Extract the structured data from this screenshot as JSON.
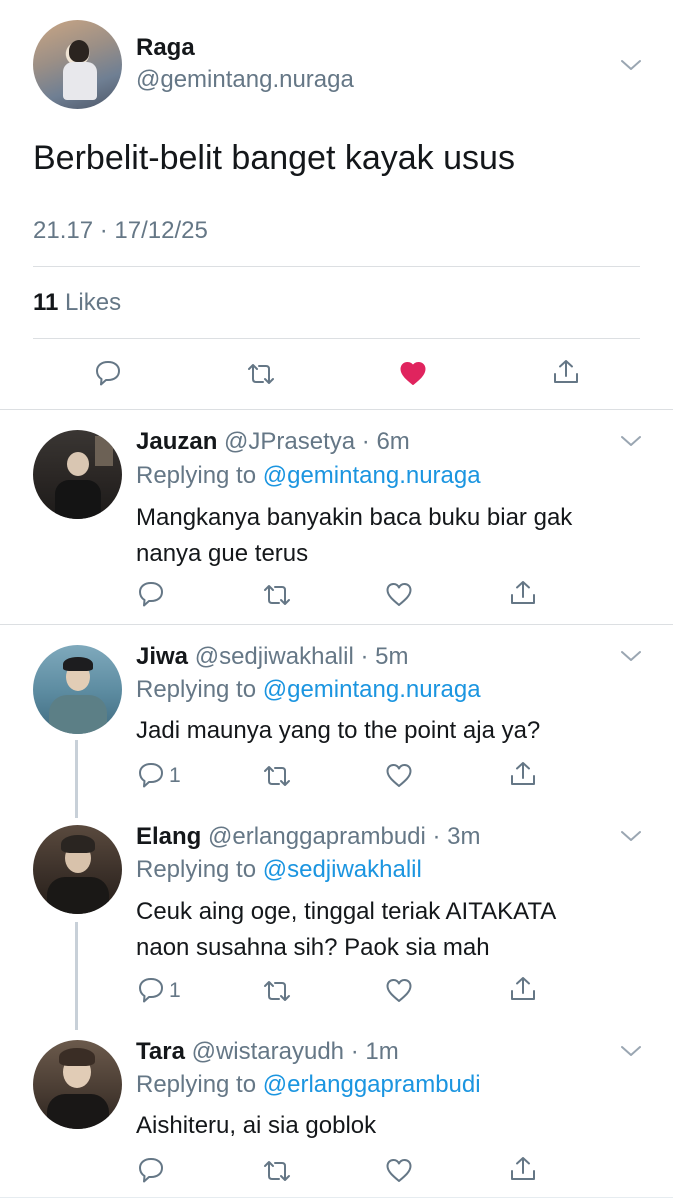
{
  "main_tweet": {
    "name": "Raga",
    "handle": "@gemintang.nuraga",
    "text": "Berbelit-belit banget kayak usus",
    "timestamp": "21.17 · 17/12/25",
    "likes_count": "11",
    "likes_label": "Likes",
    "liked": true
  },
  "replies": [
    {
      "name": "Jauzan",
      "meta": "@JPrasetya · 6m",
      "replying_label": "Replying to",
      "replying_to": "@gemintang.nuraga",
      "text_line1": "Mangkanya banyakin baca buku biar gak",
      "text_line2": "nanya gue terus",
      "reply_count": ""
    },
    {
      "name": "Jiwa",
      "meta": "@sedjiwakhalil · 5m",
      "replying_label": "Replying to",
      "replying_to": "@gemintang.nuraga",
      "text_line1": "Jadi maunya yang to the point aja ya?",
      "text_line2": "",
      "reply_count": "1"
    },
    {
      "name": "Elang",
      "meta": "@erlanggaprambudi · 3m",
      "replying_label": "Replying to",
      "replying_to": "@sedjiwakhalil",
      "text_line1": "Ceuk aing oge, tinggal teriak AITAKATA",
      "text_line2": "naon susahna sih? Paok sia mah",
      "reply_count": "1"
    },
    {
      "name": "Tara",
      "meta": "@wistarayudh · 1m",
      "replying_label": "Replying to",
      "replying_to": "@erlanggaprambudi",
      "text_line1": "Aishiteru, ai sia goblok",
      "text_line2": "",
      "reply_count": ""
    }
  ],
  "colors": {
    "like": "#e0245e",
    "link": "#1b95e0",
    "muted": "#657786",
    "icon": "#657786"
  },
  "icons": [
    "reply-icon",
    "retweet-icon",
    "heart-icon",
    "share-icon",
    "chevron-down-icon"
  ]
}
